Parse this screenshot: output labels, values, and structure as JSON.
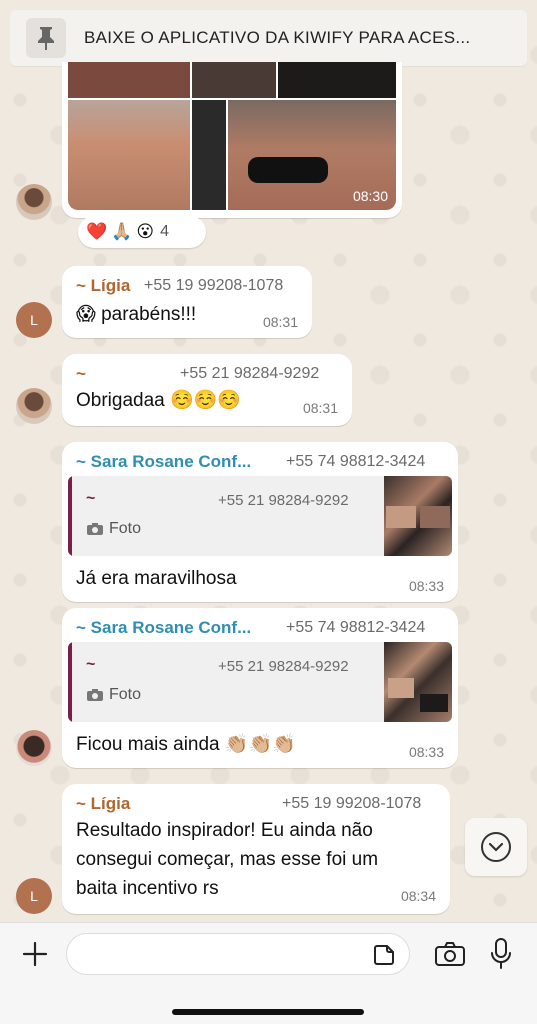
{
  "pinned": {
    "text": "BAIXE O APLICATIVO DA KIWIFY PARA ACES..."
  },
  "image_message": {
    "time": "08:30",
    "reactions": {
      "emojis": [
        "❤️",
        "🙏🏼",
        "😮"
      ],
      "count": "4"
    }
  },
  "messages": [
    {
      "sender": "~ Lígia",
      "phone": "+55 19 99208-1078",
      "text": "😱 parabéns!!!",
      "time": "08:31",
      "avatar_letter": "L"
    },
    {
      "sender": "~",
      "phone": "+55 21 98284-9292",
      "text": "Obrigadaa ☺️☺️☺️",
      "time": "08:31"
    },
    {
      "sender": "~ Sara Rosane Conf...",
      "phone": "+55 74 98812-3424",
      "quote": {
        "sender": "~",
        "phone": "+55 21 98284-9292",
        "label": "Foto"
      },
      "text": "Já era maravilhosa",
      "time": "08:33"
    },
    {
      "sender": "~ Sara Rosane Conf...",
      "phone": "+55 74 98812-3424",
      "quote": {
        "sender": "~",
        "phone": "+55 21 98284-9292",
        "label": "Foto"
      },
      "text": "Ficou mais ainda 👏🏼👏🏼👏🏼",
      "time": "08:33"
    },
    {
      "sender": "~ Lígia",
      "phone": "+55 19 99208-1078",
      "lines": [
        "Resultado inspirador! Eu ainda não",
        "consegui começar, mas esse foi um",
        "baita incentivo rs"
      ],
      "time": "08:34",
      "avatar_letter": "L"
    }
  ],
  "colors": {
    "ligia_name": "#b0672f",
    "sara_name": "#2f8fb0",
    "quote_bar": "#7a1f4a"
  },
  "icons": {
    "pin": "pin-icon",
    "scroll_down": "chevron-down-icon",
    "add": "plus-icon",
    "sticker": "sticker-icon",
    "camera": "camera-icon",
    "mic": "microphone-icon"
  }
}
